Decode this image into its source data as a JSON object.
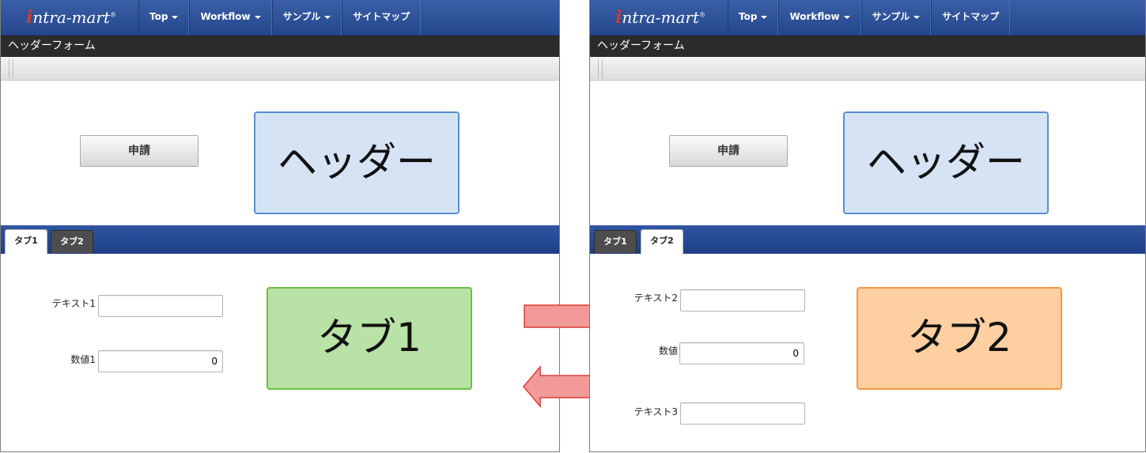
{
  "app": {
    "logo_text_i": "i",
    "logo_text_rest": "ntra-mart",
    "logo_reg": "®"
  },
  "nav": {
    "items": [
      {
        "label": "Top",
        "dropdown": true
      },
      {
        "label": "Workflow",
        "dropdown": true
      },
      {
        "label": "サンプル",
        "dropdown": true
      },
      {
        "label": "サイトマップ",
        "dropdown": false
      }
    ]
  },
  "page": {
    "title": "ヘッダーフォーム",
    "apply_button": "申請",
    "header_box": "ヘッダー"
  },
  "tabs": [
    {
      "label": "タブ1"
    },
    {
      "label": "タブ2"
    }
  ],
  "left": {
    "active_tab": "タブ1",
    "fields": [
      {
        "label": "テキスト1",
        "value": ""
      },
      {
        "label": "数値1",
        "value": "0"
      }
    ],
    "tab_box": "タブ1"
  },
  "right": {
    "active_tab": "タブ2",
    "fields": [
      {
        "label": "テキスト2",
        "value": ""
      },
      {
        "label": "数値",
        "value": "0"
      },
      {
        "label": "テキスト3",
        "value": ""
      }
    ],
    "tab_box": "タブ2"
  },
  "colors": {
    "navbar": "#2f56a2",
    "header_box_fill": "#d5e3f5",
    "tab1_box_fill": "#b9e2a6",
    "tab2_box_fill": "#fdcfa1",
    "arrow_fill": "#f19a99",
    "arrow_stroke": "#e03c36"
  },
  "icons": {
    "arrow_right": "arrow-right-icon",
    "arrow_left": "arrow-left-icon",
    "caret": "caret-down-icon"
  }
}
